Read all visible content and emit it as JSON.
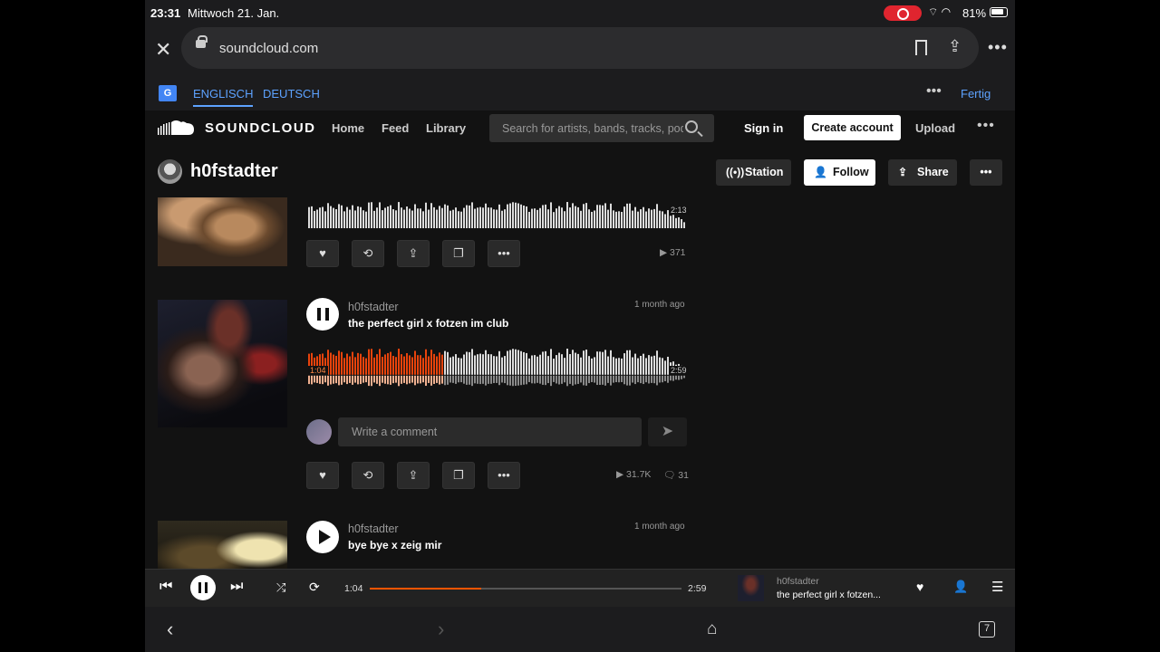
{
  "status_bar": {
    "time": "23:31",
    "date": "Mittwoch 21. Jan.",
    "battery": "81%"
  },
  "browser": {
    "url": "soundcloud.com",
    "tabs_count": "7"
  },
  "translate": {
    "lang_active": "ENGLISCH",
    "lang_other": "DEUTSCH",
    "done": "Fertig"
  },
  "header": {
    "brand": "SOUNDCLOUD",
    "nav": [
      "Home",
      "Feed",
      "Library"
    ],
    "search_placeholder": "Search for artists, bands, tracks, podcasts",
    "sign_in": "Sign in",
    "create_account": "Create account",
    "upload": "Upload"
  },
  "profile": {
    "name": "h0fstadter",
    "buttons": {
      "station": "Station",
      "follow": "Follow",
      "share": "Share"
    }
  },
  "tracks": [
    {
      "duration": "2:13",
      "plays": "371"
    },
    {
      "user": "h0fstadter",
      "title": "the perfect girl x fotzen im club",
      "age": "1 month ago",
      "elapsed": "1:04",
      "duration": "2:59",
      "progress": 0.357,
      "plays": "31.7K",
      "comments": "31",
      "comment_placeholder": "Write a comment"
    },
    {
      "user": "h0fstadter",
      "title": "bye bye x zeig mir",
      "age": "1 month ago"
    }
  ],
  "player": {
    "elapsed": "1:04",
    "duration": "2:59",
    "progress": 0.357,
    "user": "h0fstadter",
    "title": "the perfect girl x fotzen..."
  },
  "colors": {
    "accent": "#ff5500",
    "background": "#121212"
  },
  "icons": {
    "action_buttons": [
      "heart-icon",
      "repost-icon",
      "share-icon",
      "copy-icon",
      "more-icon"
    ],
    "player": [
      "skip-back-icon",
      "pause-icon",
      "skip-forward-icon",
      "shuffle-icon",
      "repeat-icon",
      "heart-icon",
      "follow-icon",
      "queue-icon"
    ]
  }
}
